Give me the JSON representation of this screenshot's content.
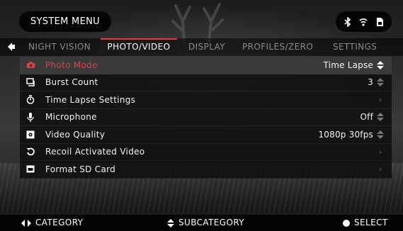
{
  "header": {
    "title": "SYSTEM MENU",
    "status_icons": [
      "bluetooth-icon",
      "wifi-icon",
      "sd-card-icon"
    ]
  },
  "tabs": [
    {
      "label": "NIGHT VISION",
      "active": false
    },
    {
      "label": "PHOTO/VIDEO",
      "active": true
    },
    {
      "label": "DISPLAY",
      "active": false
    },
    {
      "label": "PROFILES/ZERO",
      "active": false
    },
    {
      "label": "SETTINGS",
      "active": false
    }
  ],
  "menu": {
    "items": [
      {
        "icon": "camera-icon",
        "label": "Photo Mode",
        "value": "Time Lapse",
        "control": "updown",
        "selected": true
      },
      {
        "icon": "burst-icon",
        "label": "Burst Count",
        "value": "3",
        "control": "updown",
        "selected": false
      },
      {
        "icon": "stopwatch-icon",
        "label": "Time Lapse Settings",
        "value": "",
        "control": "chevron",
        "selected": false
      },
      {
        "icon": "microphone-icon",
        "label": "Microphone",
        "value": "Off",
        "control": "updown",
        "selected": false
      },
      {
        "icon": "video-quality-icon",
        "label": "Video Quality",
        "value": "1080p 30fps",
        "control": "updown",
        "selected": false
      },
      {
        "icon": "recoil-icon",
        "label": "Recoil Activated Video",
        "value": "",
        "control": "chevron",
        "selected": false
      },
      {
        "icon": "sd-card-icon",
        "label": "Format SD Card",
        "value": "",
        "control": "chevron",
        "selected": false
      }
    ]
  },
  "footer": {
    "category": "CATEGORY",
    "subcategory": "SUBCATEGORY",
    "select": "SELECT"
  },
  "colors": {
    "accent": "#e53c3c",
    "text": "#f2f2f2",
    "inactive_tab": "#8a8a8a"
  }
}
